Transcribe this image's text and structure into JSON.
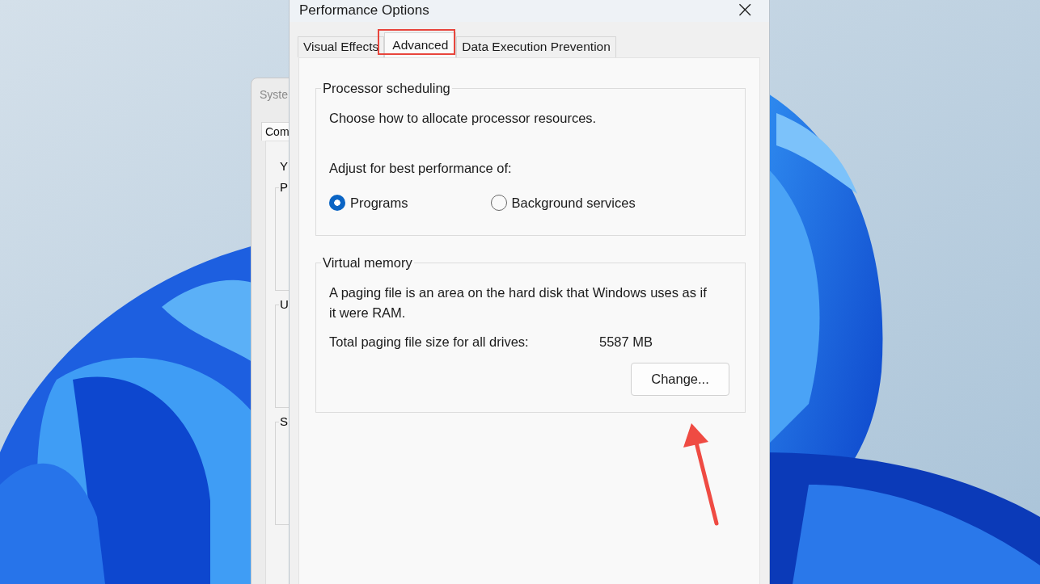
{
  "system_window": {
    "title": "Syste",
    "tabs": [
      {
        "label": "Com",
        "selected": true
      }
    ],
    "intro": "Y",
    "groups": [
      {
        "legend": "P"
      },
      {
        "legend": "U"
      },
      {
        "legend": "S"
      }
    ]
  },
  "window": {
    "title": "Performance Options",
    "close": "×"
  },
  "tabs": [
    {
      "label": "Visual Effects",
      "selected": false
    },
    {
      "label": "Advanced",
      "selected": true
    },
    {
      "label": "Data Execution Prevention",
      "selected": false
    }
  ],
  "processor_scheduling": {
    "legend": "Processor scheduling",
    "description": "Choose how to allocate processor resources.",
    "prompt": "Adjust for best performance of:",
    "options": [
      {
        "label": "Programs",
        "selected": true
      },
      {
        "label": "Background services",
        "selected": false
      }
    ]
  },
  "virtual_memory": {
    "legend": "Virtual memory",
    "description": "A paging file is an area on the hard disk that Windows uses as if it were RAM.",
    "total_label": "Total paging file size for all drives:",
    "total_value": "5587 MB",
    "button": "Change..."
  }
}
